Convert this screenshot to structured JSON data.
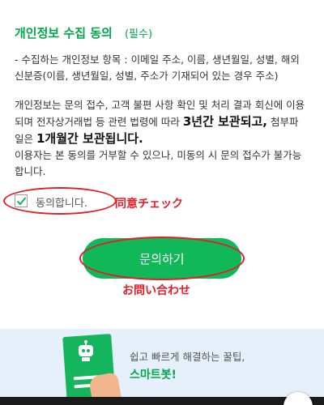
{
  "consent": {
    "title": "개인정보 수집 동의",
    "required_tag": "(필수)",
    "items_lines": [
      "- 수집하는 개인정보 항목 : 이메일 주소, 이름, 생년월일, 성별, 해외",
      "신분증(이름, 생년월일, 성별, 주소가 기재되어 있는 경우 주소)"
    ],
    "policy": {
      "line1": "개인정보는 문의 접수, 고객 불편 사항 확인 및 처리 결과 회신에 이용",
      "line2_prefix": "되며 전자상거래법 등 관련 법령에 따라 ",
      "retention_main": "3년간 보관되고,",
      "line2_suffix": " 첨부파",
      "line3_prefix": "일은 ",
      "retention_attach": "1개월간 보관됩니다.",
      "line4": "이용자는 본 동의를 거부할 수 있으나, 미동의 시 문의 접수가 불가능",
      "line5": "합니다."
    },
    "agree_label": "동의합니다.",
    "agree_checked": true
  },
  "annotations": {
    "agree_note": "同意チェック",
    "inquiry_note": "お問い合わせ"
  },
  "actions": {
    "inquiry_button": "문의하기"
  },
  "banner": {
    "line1": "쉽고 빠르게 해결하는 꿀팁,",
    "line2": "스마트봇!"
  },
  "colors": {
    "brand_green": "#03a74a",
    "button_green": "#10b85a",
    "annotation_red": "#e21e28",
    "banner_bg": "#e6f0fb"
  }
}
